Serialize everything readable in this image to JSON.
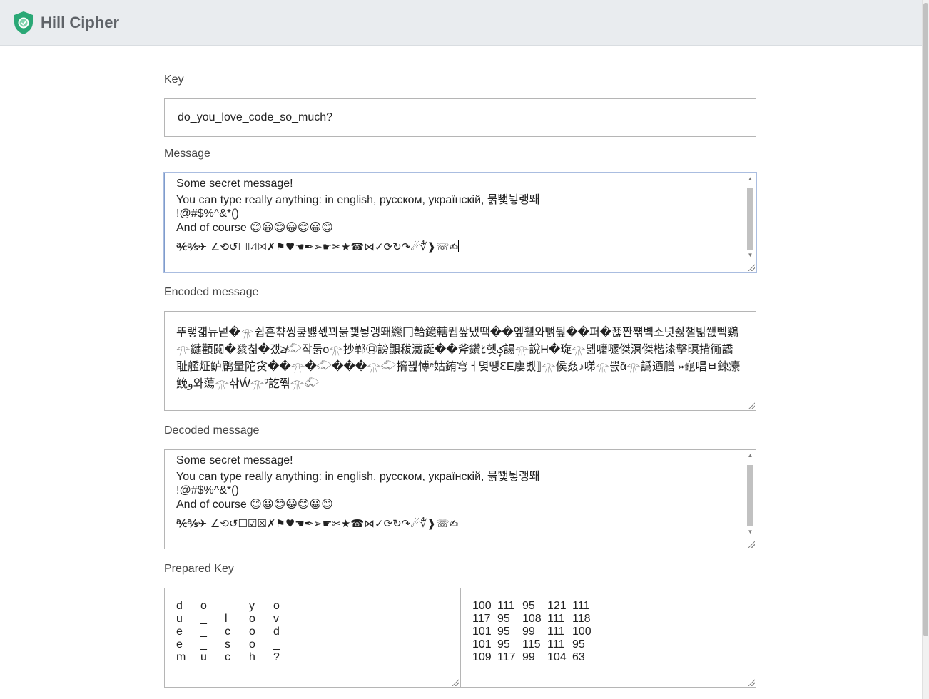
{
  "app": {
    "title": "Hill Cipher",
    "logo_icon": "shield-check-icon",
    "accent": "#2aa876"
  },
  "key": {
    "label": "Key",
    "value": "do_you_love_code_so_much?"
  },
  "message": {
    "label": "Message",
    "lines": [
      "Some secret message!",
      "You can type really anything: in english, русском, українскій, 묽뾏뉳랭뙈",
      "!@#$%^&*()",
      "And of course ",
      "℀℁✈ ∠⟲↺☐☑☒✗⚑♥☚✒➢☛✂★☎⋈✓⟳↻↷☄∜❱☏✍"
    ],
    "emojis": "😊😀😊😀😊😀😊"
  },
  "encoded": {
    "label": "Encoded message",
    "value": "뚜랳걟뉴넡�𓁿쉽혼챢씽쿺뱷섻꾀묽뾏뉳랭뙈纞冂韐鐿轄뭽쌒냈땍��엪휄와뻙뒆��퍼�쬲짠쨲볙소녓쥟챌빎쐢삑鷄𓁿鍵顴䦧�𗯿칢�갰≱𓄁작둙ο𓁿抄郸㋺謗鼰秡瀻誕��斧鑽ﾋ헷ؼ諹𓁿說H�琁𓁿뎲嚰嚺傑溟傑楷漆擊暝揹衕譑耻艦炡鲈鹛量陀贪��𓁿�𓄁���𓁿𓄁搚끮愽ᵉ姑銪穹ㅓ몇땡ꜪE廔볬⟧𓁿侯姦♪㖒𓁿쁤ᾰ𓁿譌迺膳⤞龜唱ㅂ鍊癳鮸ﻭ와蕩𓁿삮Ẃ𓁿ˀ訖쭦𓁿𓄁"
  },
  "decoded": {
    "label": "Decoded message",
    "lines": [
      "Some secret message!",
      "You can type really anything: in english, русском, українскій, 묽뾏뉳랭뙈",
      "!@#$%^&*()",
      "And of course ",
      "℀℁✈ ∠⟲↺☐☑☒✗⚑♥☚✒➢☛✂★☎⋈✓⟳↻↷☄∜❱☏✍"
    ],
    "emojis": "😊😀😊😀😊😀😊"
  },
  "prepared_key": {
    "label": "Prepared Key",
    "chars": [
      [
        "d",
        "o",
        "_",
        "y",
        "o"
      ],
      [
        "u",
        "_",
        "l",
        "o",
        "v"
      ],
      [
        "e",
        "_",
        "c",
        "o",
        "d"
      ],
      [
        "e",
        "_",
        "s",
        "o",
        "_"
      ],
      [
        "m",
        "u",
        "c",
        "h",
        "?"
      ]
    ],
    "numbers": [
      [
        "100",
        "111",
        "95",
        "121",
        "111"
      ],
      [
        "117",
        "95",
        "108",
        "111",
        "118"
      ],
      [
        "101",
        "95",
        "99",
        "111",
        "100"
      ],
      [
        "101",
        "95",
        "115",
        "111",
        "95"
      ],
      [
        "109",
        "117",
        "99",
        "104",
        "63"
      ]
    ]
  }
}
